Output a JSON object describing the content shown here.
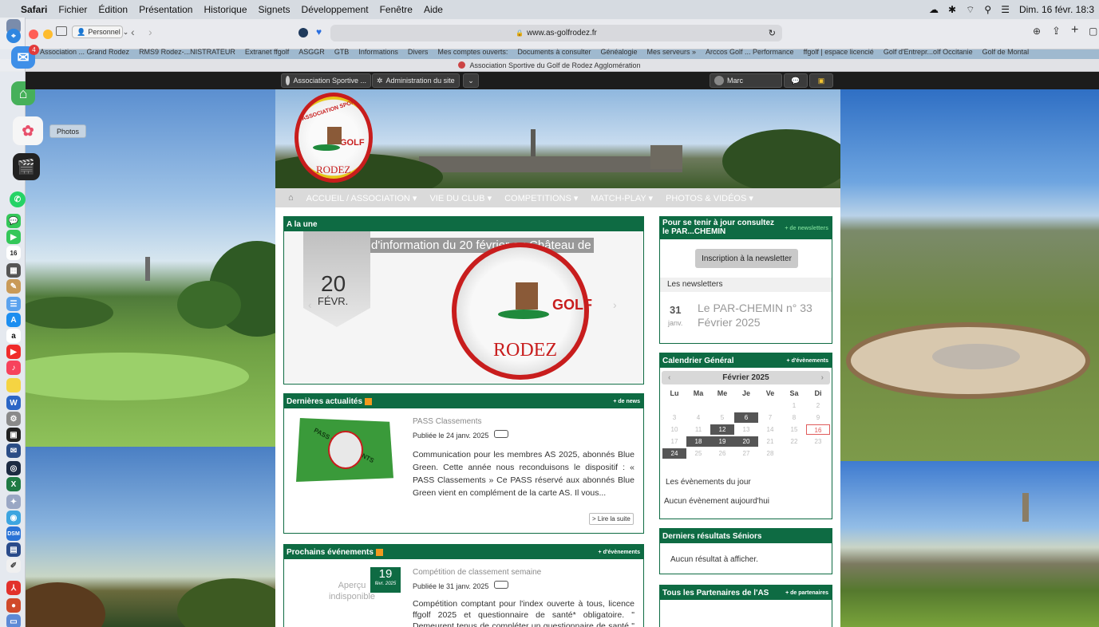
{
  "menubar": {
    "app": "Safari",
    "items": [
      "Fichier",
      "Édition",
      "Présentation",
      "Historique",
      "Signets",
      "Développement",
      "Fenêtre",
      "Aide"
    ],
    "clock": "Dim. 16 févr. 18:3"
  },
  "toolbar": {
    "profile": "Personnel",
    "url": "www.as-golfrodez.fr"
  },
  "bookmarks": [
    "Association ... Grand Rodez",
    "RMS9 Rodez-...NISTRATEUR",
    "Extranet ffgolf",
    "ASGGR",
    "GTB",
    "Informations",
    "Divers",
    "Mes comptes ouverts:",
    "Documents à consulter",
    "Généalogie",
    "Mes serveurs »",
    "Arccos Golf ... Performance",
    "ffgolf | espace licencié",
    "Golf d'Entrepr...olf Occitanie",
    "Golf de Montal"
  ],
  "tab": {
    "title": "Association Sportive du Golf de Rodez Agglomération"
  },
  "dock": {
    "tooltip": "Photos",
    "badges": {
      "mail": "4",
      "calendar": "16"
    }
  },
  "adminbar": {
    "site": "Association Sportive ...",
    "admin": "Administration du site",
    "user": "Marc"
  },
  "logo": {
    "text_top": "ASSOCIATION SPORTIVE",
    "golf": "GOLF",
    "city": "RODEZ"
  },
  "nav": [
    "ACCUEIL / ASSOCIATION",
    "VIE DU CLUB",
    "COMPETITIONS",
    "MATCH-PLAY",
    "PHOTOS & VIDÉOS"
  ],
  "une": {
    "title": "A la une",
    "headline": "Réunion d'information du 20 février au Château de",
    "day": "20",
    "month": "FÉVR."
  },
  "news": {
    "title": "Dernières actualités",
    "more": "+ de news",
    "item_title": "PASS Classements",
    "published": "Publiée le 24 janv. 2025",
    "excerpt": "Communication pour les membres AS 2025, abonnés Blue Green. Cette année nous reconduisons le dispositif : « PASS Classements »   Ce PASS réservé aux abonnés Blue Green vient en complément de la carte AS.   Il vous...",
    "read_more": "> Lire la suite",
    "stamp_text": "PASS CLASSEMENTS"
  },
  "events": {
    "title": "Prochains événements",
    "more": "+ d'évènements",
    "item_title": "Compétition de classement semaine",
    "published": "Publiée le 31 janv. 2025",
    "day": "19",
    "date_label": "févr. 2025",
    "placeholder": "Aperçu indisponible",
    "excerpt": "Compétition comptant pour l'index ouverte à tous, licence ffgolf 2025 et questionnaire de santé* obligatoire.      \" Demeurent tenus de compléter un questionnaire de santé \" Les Licenciés..."
  },
  "newsletter": {
    "title": "Pour se tenir à jour consultez le PAR...CHEMIN",
    "more": "+ de newsletters",
    "button": "Inscription à la newsletter",
    "list_label": "Les newsletters",
    "day": "31",
    "month": "janv.",
    "item": "Le PAR-CHEMIN n° 33 Février 2025"
  },
  "calendar": {
    "title": "Calendrier Général",
    "more": "+ d'évènements",
    "month": "Février 2025",
    "weekdays": [
      "Lu",
      "Ma",
      "Me",
      "Je",
      "Ve",
      "Sa",
      "Di"
    ],
    "cells": [
      "",
      "",
      "",
      "",
      "",
      "1",
      "2",
      "3",
      "4",
      "5",
      "6",
      "7",
      "8",
      "9",
      "10",
      "11",
      "12",
      "13",
      "14",
      "15",
      "16",
      "17",
      "18",
      "19",
      "20",
      "21",
      "22",
      "23",
      "24",
      "25",
      "26",
      "27",
      "28",
      "",
      ""
    ],
    "event_days": [
      "6",
      "12",
      "18",
      "19",
      "20",
      "24"
    ],
    "today": "16",
    "events_today": "Les évènements du jour",
    "no_events": "Aucun évènement aujourd'hui"
  },
  "results": {
    "title": "Derniers résultats Séniors",
    "empty": "Aucun résultat à afficher."
  },
  "partners": {
    "title": "Tous les Partenaires de l'AS",
    "more": "+ de partenaires"
  },
  "colors": {
    "accent": "#0e6b43",
    "menubar": "#d6dbe1"
  }
}
